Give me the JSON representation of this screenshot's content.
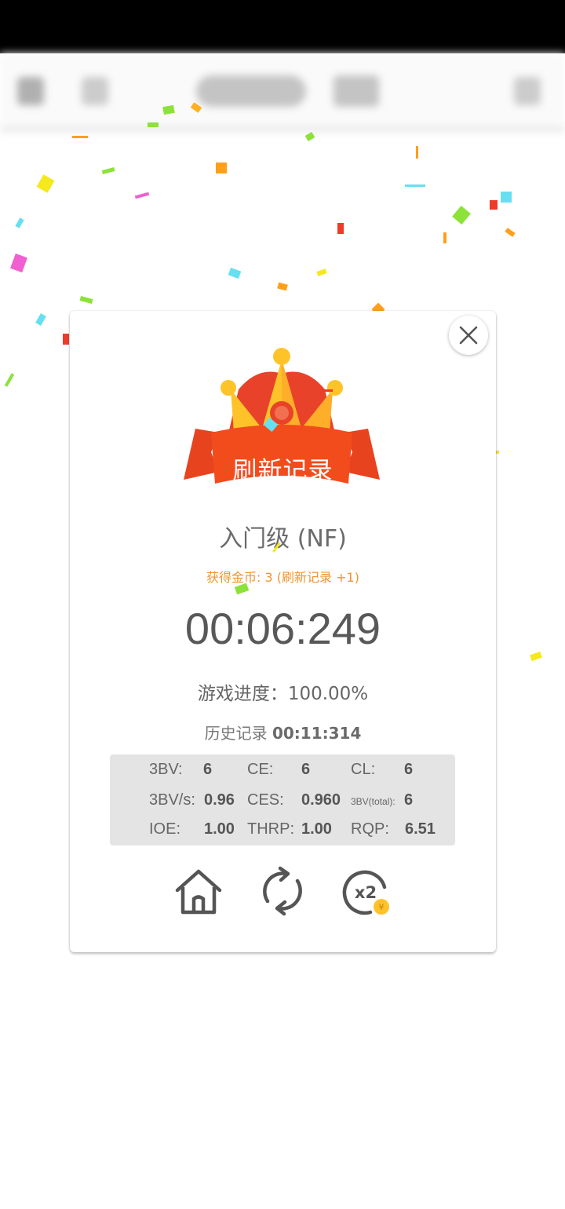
{
  "dialog": {
    "badge": "刷新记录",
    "level": "入门级 (NF)",
    "coins_text": "获得金币: 3 (刷新记录 +1)",
    "time": "00:06:249",
    "progress": "游戏进度：100.00%",
    "history_label": "历史记录",
    "history_time": "00:11:314",
    "stats": {
      "r1": {
        "l1": "3BV:",
        "v1": "6",
        "l2": "CE:",
        "v2": "6",
        "l3": "CL:",
        "v3": "6"
      },
      "r2": {
        "l1": "3BV/s:",
        "v1": "0.96",
        "l2": "CES:",
        "v2": "0.960",
        "l3": "3BV(total):",
        "v3": "6"
      },
      "r3": {
        "l1": "IOE:",
        "v1": "1.00",
        "l2": "THRP:",
        "v2": "1.00",
        "l3": "RQP:",
        "v3": "6.51"
      }
    },
    "actions": {
      "home_icon": "home-icon",
      "restart_icon": "restart-icon",
      "double_icon": "double-coins-icon",
      "double_label": "x2",
      "coin_label": "¥"
    }
  },
  "colors": {
    "accent": "#f0952d",
    "ribbon": "#e8431f",
    "crown_gold": "#ffc32a"
  }
}
